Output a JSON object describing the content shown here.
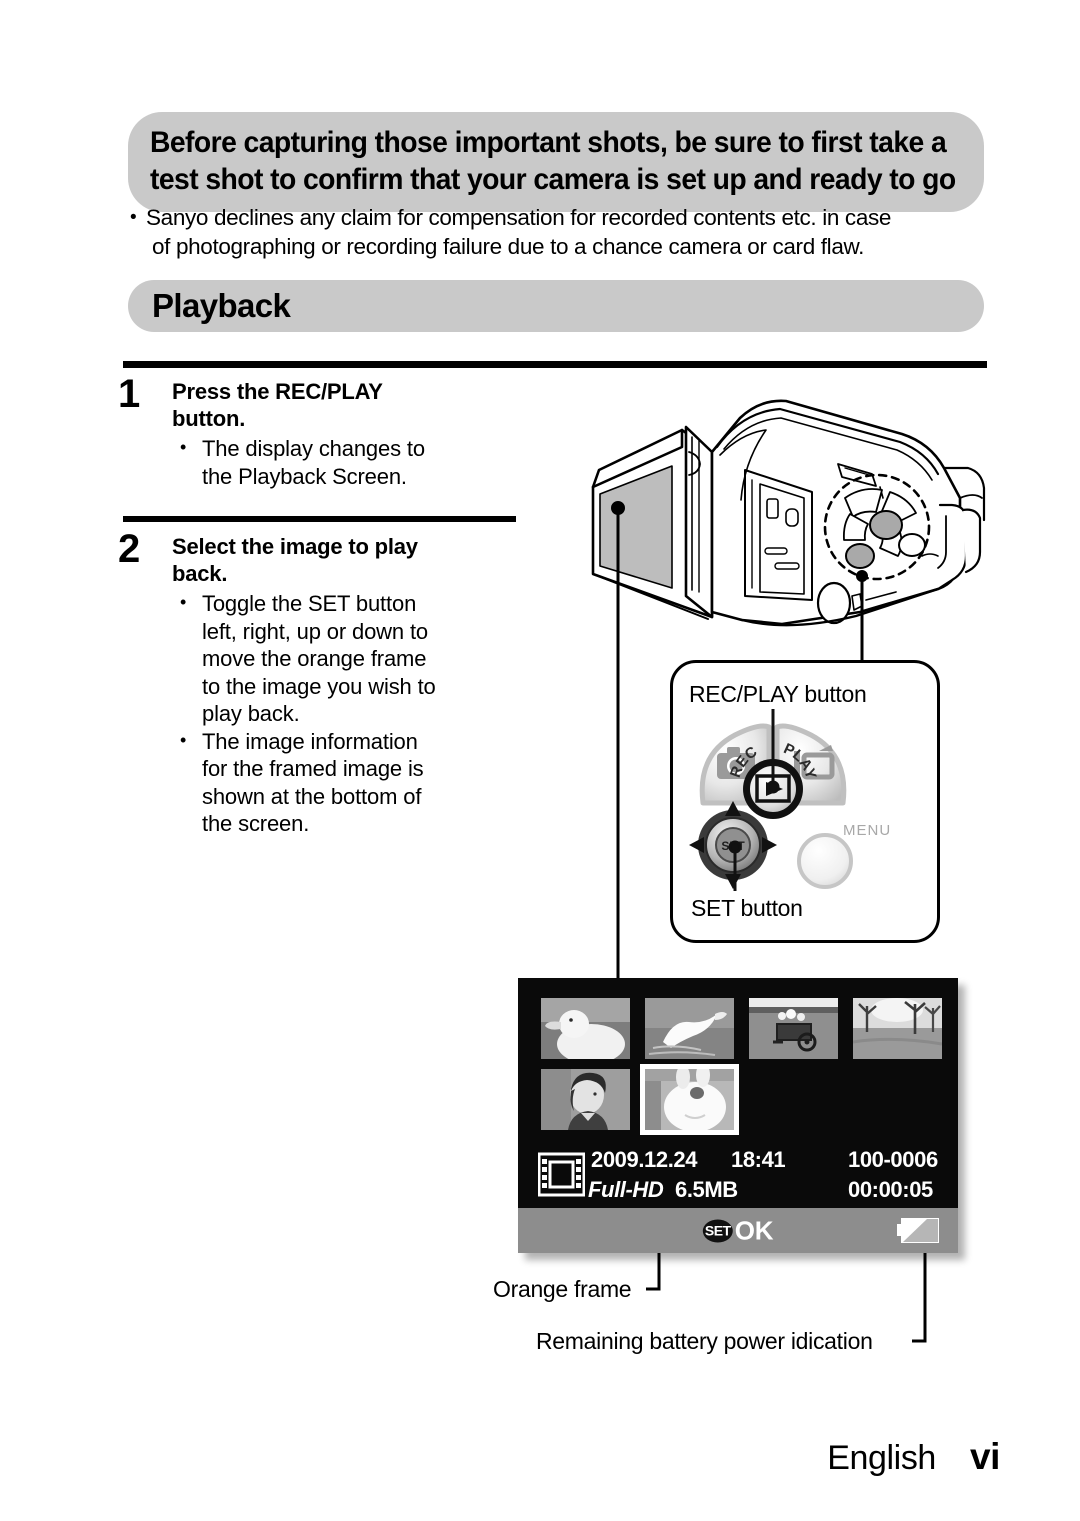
{
  "notice": {
    "banner_lines": [
      "Before capturing those important shots, be sure to first take a",
      "test shot to confirm that your camera is set up and ready to go"
    ],
    "bullet_lines": [
      "Sanyo declines any claim for compensation for recorded contents etc. in case",
      "of photographing or recording failure due to a chance camera or card flaw."
    ],
    "bullet_marker": "•"
  },
  "section": {
    "title": "Playback"
  },
  "steps": [
    {
      "number": "1",
      "title_lines": [
        "Press the REC/PLAY",
        "button."
      ],
      "bullets": [
        [
          "The display changes to",
          "the Playback Screen."
        ]
      ]
    },
    {
      "number": "2",
      "title_lines": [
        "Select the image to play",
        "back."
      ],
      "bullets": [
        [
          "Toggle the SET button",
          "left, right, up or down to",
          "move the orange frame",
          "to the image you wish to",
          "play back."
        ],
        [
          "The image information",
          "for the framed image is",
          "shown at the bottom of",
          "the screen."
        ]
      ]
    }
  ],
  "callout": {
    "recplay_label": "REC/PLAY button",
    "set_label": "SET button",
    "set_button_text": "SET",
    "menu_label": "MENU",
    "rec_arc_text": "REC",
    "play_arc_text": "PLAY"
  },
  "playback_screen": {
    "thumbnails": [
      {
        "name": "duck-head",
        "selected": false
      },
      {
        "name": "swan-water",
        "selected": false
      },
      {
        "name": "flower-cart",
        "selected": false
      },
      {
        "name": "trees-field",
        "selected": false
      },
      {
        "name": "girl-portrait",
        "selected": false
      },
      {
        "name": "rabbit-face",
        "selected": true
      }
    ],
    "info": {
      "date": "2009.12.24",
      "time": "18:41",
      "file_number": "100-0006",
      "quality": "Full-HD",
      "file_size": "6.5MB",
      "duration": "00:00:05"
    },
    "status": {
      "set_badge": "SET",
      "ok_text": "OK"
    }
  },
  "annotations": {
    "orange_frame": "Orange frame",
    "battery": "Remaining battery power idication"
  },
  "footer": {
    "language": "English",
    "page": "vi"
  },
  "colors": {
    "banner_gray": "#c9c9c9",
    "screen_black": "#0a0a0a",
    "status_gray": "#8d8d8d",
    "text_black": "#000000",
    "white": "#ffffff"
  }
}
